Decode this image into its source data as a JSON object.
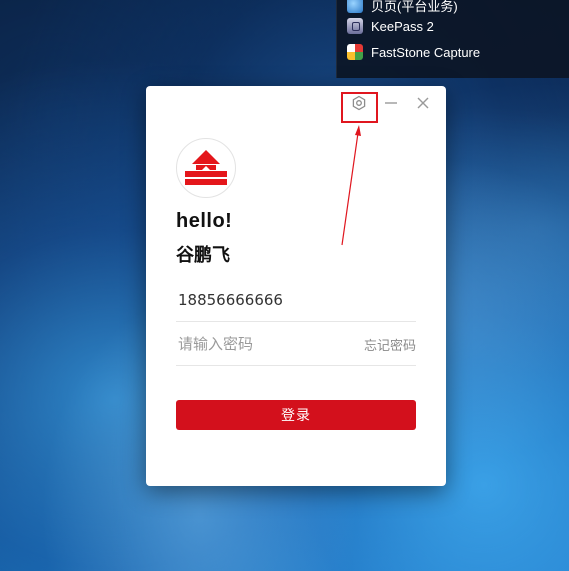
{
  "start_menu": {
    "items": [
      {
        "label": "贝页(平台业务)",
        "icon": "browser-icon"
      },
      {
        "label": "KeePass 2",
        "icon": "keepass-icon"
      },
      {
        "label": "FastStone Capture",
        "icon": "faststone-capture-icon"
      }
    ]
  },
  "login": {
    "greeting": "hello!",
    "username": "谷鹏飞",
    "phone_value": "18856666666",
    "password_placeholder": "请输入密码",
    "forgot_password": "忘记密码",
    "login_button": "登录",
    "logo_icon": "bank-logo-icon",
    "brand_color": "#d3101c"
  },
  "window_controls": {
    "settings_icon": "settings-icon",
    "minimize_icon": "minimize-icon",
    "close_icon": "close-icon"
  },
  "annotation": {
    "highlight_color": "#e0161f"
  }
}
